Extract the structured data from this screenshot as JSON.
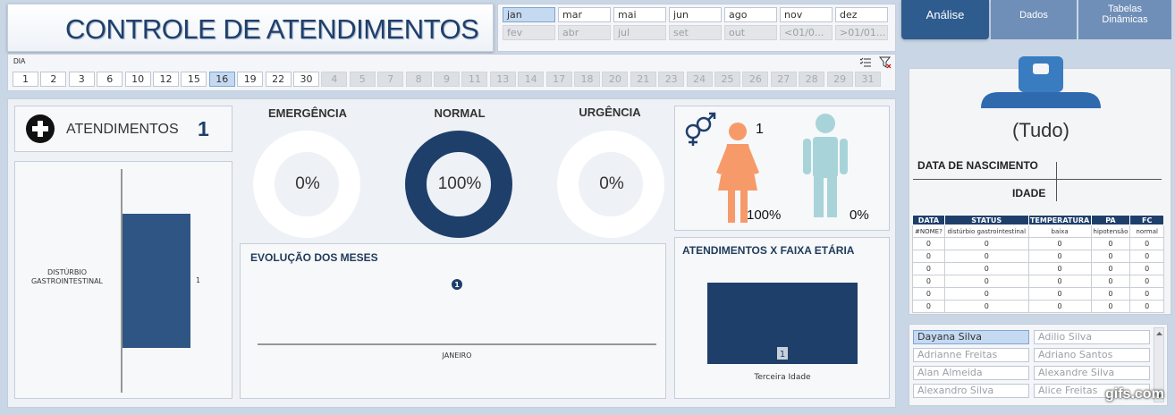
{
  "title": "CONTROLE DE ATENDIMENTOS",
  "months": [
    {
      "label": "jan",
      "state": "sel"
    },
    {
      "label": "mar",
      "state": ""
    },
    {
      "label": "mai",
      "state": ""
    },
    {
      "label": "jun",
      "state": ""
    },
    {
      "label": "ago",
      "state": ""
    },
    {
      "label": "nov",
      "state": ""
    },
    {
      "label": "dez",
      "state": ""
    },
    {
      "label": "fev",
      "state": "dis"
    },
    {
      "label": "abr",
      "state": "dis"
    },
    {
      "label": "jul",
      "state": "dis"
    },
    {
      "label": "set",
      "state": "dis"
    },
    {
      "label": "out",
      "state": "dis"
    },
    {
      "label": "<01/0...",
      "state": "dis"
    },
    {
      "label": ">01/01...",
      "state": "dis"
    }
  ],
  "day_slicer": {
    "label": "DIA",
    "days": [
      {
        "label": "1",
        "state": ""
      },
      {
        "label": "2",
        "state": ""
      },
      {
        "label": "3",
        "state": ""
      },
      {
        "label": "6",
        "state": ""
      },
      {
        "label": "10",
        "state": ""
      },
      {
        "label": "12",
        "state": ""
      },
      {
        "label": "15",
        "state": ""
      },
      {
        "label": "16",
        "state": "sel"
      },
      {
        "label": "19",
        "state": ""
      },
      {
        "label": "22",
        "state": ""
      },
      {
        "label": "30",
        "state": ""
      },
      {
        "label": "4",
        "state": "dis"
      },
      {
        "label": "5",
        "state": "dis"
      },
      {
        "label": "7",
        "state": "dis"
      },
      {
        "label": "8",
        "state": "dis"
      },
      {
        "label": "9",
        "state": "dis"
      },
      {
        "label": "11",
        "state": "dis"
      },
      {
        "label": "13",
        "state": "dis"
      },
      {
        "label": "14",
        "state": "dis"
      },
      {
        "label": "17",
        "state": "dis"
      },
      {
        "label": "18",
        "state": "dis"
      },
      {
        "label": "20",
        "state": "dis"
      },
      {
        "label": "21",
        "state": "dis"
      },
      {
        "label": "23",
        "state": "dis"
      },
      {
        "label": "24",
        "state": "dis"
      },
      {
        "label": "25",
        "state": "dis"
      },
      {
        "label": "26",
        "state": "dis"
      },
      {
        "label": "27",
        "state": "dis"
      },
      {
        "label": "28",
        "state": "dis"
      },
      {
        "label": "29",
        "state": "dis"
      },
      {
        "label": "31",
        "state": "dis"
      }
    ]
  },
  "tabs": {
    "analise": "Análise",
    "dados": "Dados",
    "tabelas_line1": "Tabelas",
    "tabelas_line2": "Dinâmicas"
  },
  "atendimentos": {
    "label": "ATENDIMENTOS",
    "count": "1"
  },
  "colors": {
    "navy": "#1f3f6b",
    "bar": "#2f5584",
    "female": "#f79a6a",
    "male": "#a8d4d9"
  },
  "gender": {
    "female_count": "1",
    "female_pct": "100%",
    "male_pct": "0%"
  },
  "right": {
    "name": "(Tudo)",
    "birth_label": "DATA DE NASCIMENTO",
    "age_label": "IDADE",
    "table": {
      "headers": [
        "DATA",
        "STATUS",
        "TEMPERATURA",
        "PA",
        "FC"
      ],
      "rows": [
        [
          "#NOME?",
          "distúrbio gastrointestinal",
          "baixa",
          "hipotensão",
          "normal"
        ],
        [
          "0",
          "0",
          "0",
          "0",
          "0"
        ],
        [
          "0",
          "0",
          "0",
          "0",
          "0"
        ],
        [
          "0",
          "0",
          "0",
          "0",
          "0"
        ],
        [
          "0",
          "0",
          "0",
          "0",
          "0"
        ],
        [
          "0",
          "0",
          "0",
          "0",
          "0"
        ],
        [
          "0",
          "0",
          "0",
          "0",
          "0"
        ]
      ]
    }
  },
  "names": [
    "Dayana Silva",
    "Adilio Silva",
    "Adrianne Freitas",
    "Adriano Santos",
    "Alan Almeida",
    "Alexandre Silva",
    "Alexandro Silva",
    "Alice Freitas"
  ],
  "watermark": "gifs.com",
  "chart_data": [
    {
      "type": "bar",
      "orientation": "horizontal",
      "categories": [
        "DISTÚRBIO GASTROINTESTINAL"
      ],
      "values": [
        1
      ],
      "data_labels": [
        "1"
      ],
      "title": ""
    },
    {
      "type": "pie",
      "variant": "donut",
      "title": "EMERGÊNCIA",
      "values": [
        0
      ],
      "center_label": "0%"
    },
    {
      "type": "pie",
      "variant": "donut",
      "title": "NORMAL",
      "values": [
        1
      ],
      "center_label": "100%"
    },
    {
      "type": "pie",
      "variant": "donut",
      "title": "URGÊNCIA",
      "values": [
        0
      ],
      "center_label": "0%"
    },
    {
      "type": "line",
      "title": "EVOLUÇÃO DOS MESES",
      "categories": [
        "JANEIRO"
      ],
      "values": [
        1
      ],
      "data_labels": [
        "1"
      ]
    },
    {
      "type": "bar",
      "title": "ATENDIMENTOS X FAIXA ETÁRIA",
      "categories": [
        "Terceira Idade"
      ],
      "values": [
        1
      ],
      "data_labels": [
        "1"
      ]
    }
  ]
}
